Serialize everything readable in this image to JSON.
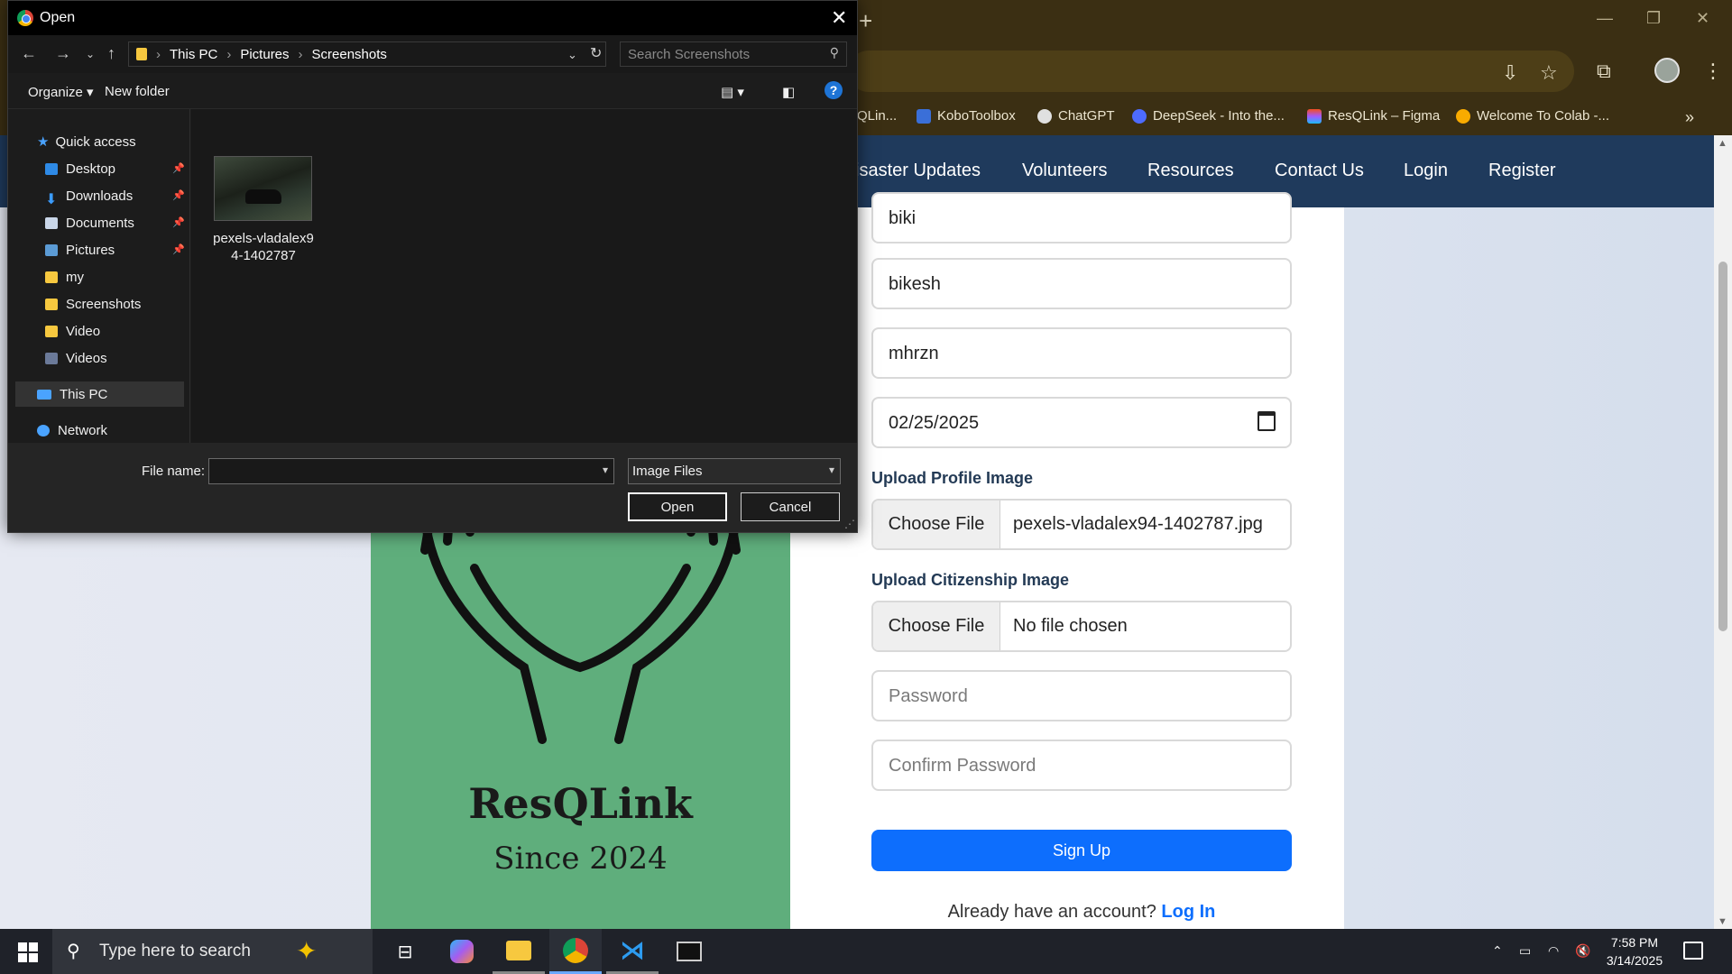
{
  "browser": {
    "bookmarks": [
      {
        "label": "QLin..."
      },
      {
        "label": "KoboToolbox"
      },
      {
        "label": "ChatGPT"
      },
      {
        "label": "DeepSeek - Into the..."
      },
      {
        "label": "ResQLink – Figma"
      },
      {
        "label": "Welcome To Colab -..."
      }
    ]
  },
  "site": {
    "nav": [
      "isaster Updates",
      "Volunteers",
      "Resources",
      "Contact Us",
      "Login",
      "Register"
    ],
    "logo_title": "ResQLink",
    "logo_sub": "Since 2024"
  },
  "form": {
    "username": "biki",
    "first_name": "bikesh",
    "last_name": "mhrzn",
    "date": "02/25/2025",
    "profile_label": "Upload Profile Image",
    "profile_button": "Choose File",
    "profile_file": "pexels-vladalex94-1402787.jpg",
    "citizenship_label": "Upload Citizenship Image",
    "citizenship_button": "Choose File",
    "citizenship_file": "No file chosen",
    "password_placeholder": "Password",
    "confirm_placeholder": "Confirm Password",
    "signup": "Sign Up",
    "already_text": "Already have an account?",
    "login_link": "Log In"
  },
  "dialog": {
    "title": "Open",
    "breadcrumb": [
      "This PC",
      "Pictures",
      "Screenshots"
    ],
    "search_placeholder": "Search Screenshots",
    "organize": "Organize",
    "new_folder": "New folder",
    "help": "?",
    "tree": [
      {
        "label": "Quick access",
        "pinned": false
      },
      {
        "label": "Desktop",
        "pinned": true
      },
      {
        "label": "Downloads",
        "pinned": true
      },
      {
        "label": "Documents",
        "pinned": true
      },
      {
        "label": "Pictures",
        "pinned": true
      },
      {
        "label": "my",
        "pinned": false
      },
      {
        "label": "Screenshots",
        "pinned": false
      },
      {
        "label": "Video",
        "pinned": false
      },
      {
        "label": "Videos",
        "pinned": false
      },
      {
        "label": "This PC",
        "pinned": false
      },
      {
        "label": "Network",
        "pinned": false
      }
    ],
    "file": {
      "name_line1": "pexels-vladalex9",
      "name_line2": "4-1402787"
    },
    "file_name_label": "File name:",
    "file_name_value": "",
    "file_type": "Image Files",
    "open": "Open",
    "cancel": "Cancel"
  },
  "taskbar": {
    "search_placeholder": "Type here to search",
    "time": "7:58 PM",
    "date": "3/14/2025"
  },
  "colors": {
    "nav_bg": "#1f3a5c",
    "logo_green": "#5fae7c",
    "accent": "#0d6efd",
    "chrome_bg": "#3b2f13"
  }
}
